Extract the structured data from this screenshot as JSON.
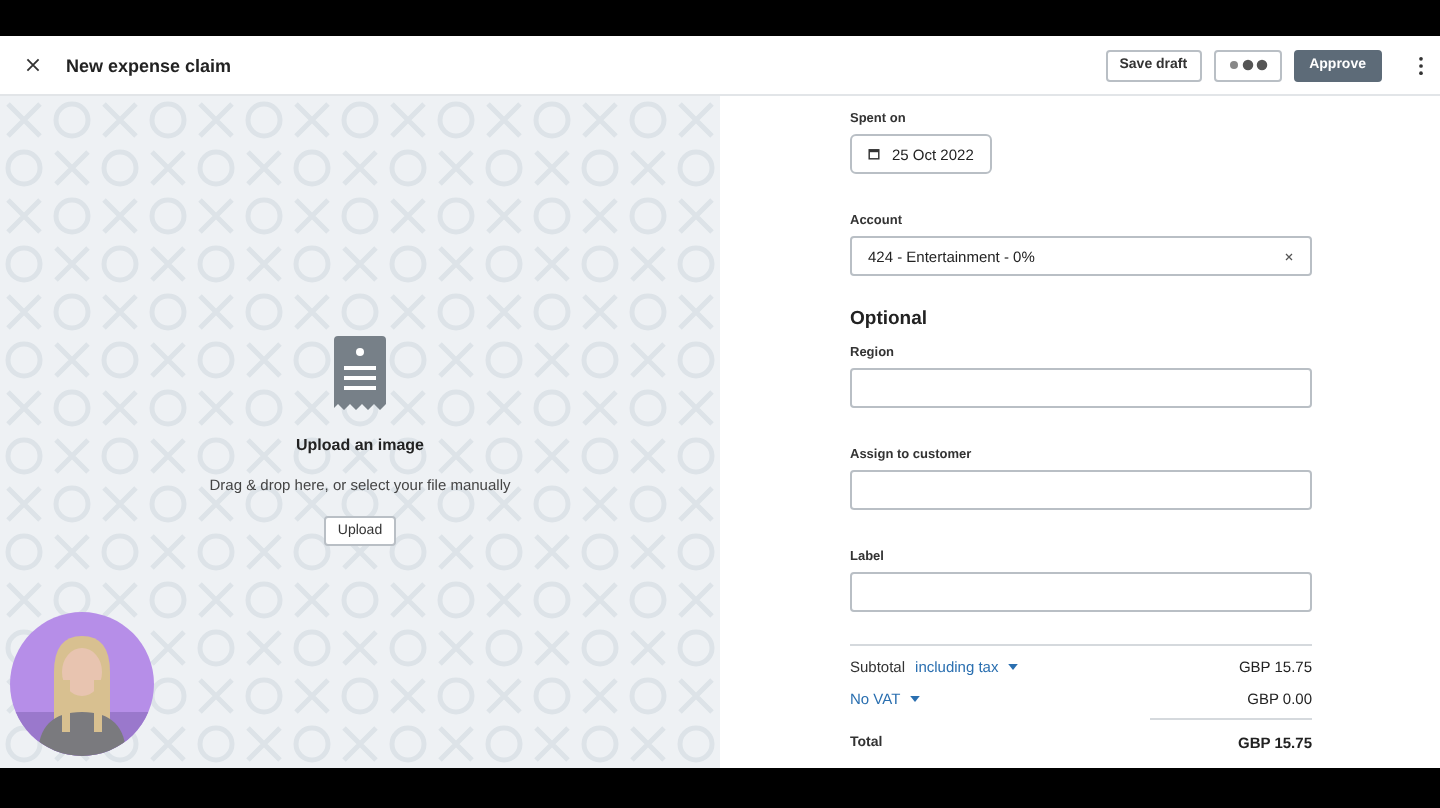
{
  "header": {
    "title": "New expense claim",
    "buttons": [
      {
        "kind": "outline",
        "label": "Save draft"
      },
      {
        "kind": "loading"
      },
      {
        "kind": "primary",
        "label": "Approve"
      }
    ]
  },
  "upload": {
    "title": "Upload an image",
    "hint": "Drag & drop here, or select your file manually",
    "button": "Upload"
  },
  "form": {
    "spent_on": {
      "label": "Spent on",
      "value": "25 Oct 2022"
    },
    "account": {
      "label": "Account",
      "value": "424 - Entertainment - 0%"
    },
    "optional_heading": "Optional",
    "fields": [
      {
        "label": "Region"
      },
      {
        "label": "Assign to customer"
      },
      {
        "label": "Label"
      }
    ]
  },
  "totals": {
    "subtotal": {
      "label": "Subtotal",
      "option": "including tax",
      "amount": "GBP 15.75"
    },
    "tax": {
      "option": "No VAT",
      "amount": "GBP 0.00"
    },
    "total": {
      "label": "Total",
      "amount": "GBP 15.75"
    }
  }
}
